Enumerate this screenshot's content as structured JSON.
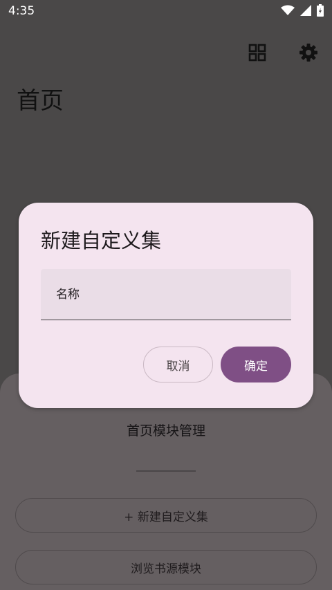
{
  "status": {
    "time": "4:35"
  },
  "header": {
    "title": "首页"
  },
  "sheet": {
    "title": "首页模块管理",
    "new_collection_label": "+ 新建自定义集",
    "browse_modules_label": "浏览书源模块"
  },
  "dialog": {
    "title": "新建自定义集",
    "name_field_label": "名称",
    "cancel_label": "取消",
    "confirm_label": "确定"
  },
  "colors": {
    "dialog_bg": "#f4e4ef",
    "primary": "#7f4f85",
    "scrim": "#4a4848"
  },
  "icons": [
    "wifi-icon",
    "signal-icon",
    "battery-icon",
    "grid-icon",
    "gear-icon"
  ]
}
